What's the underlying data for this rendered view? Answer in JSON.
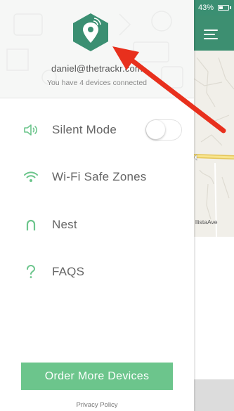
{
  "drawer": {
    "email": "daniel@thetrackr.com",
    "devices_text": "You have 4 devices connected",
    "menu": [
      {
        "label": "Silent Mode",
        "icon": "speaker-icon"
      },
      {
        "label": "Wi-Fi Safe Zones",
        "icon": "wifi-icon"
      },
      {
        "label": "Nest",
        "icon": "nest-icon"
      },
      {
        "label": "FAQS",
        "icon": "question-icon"
      }
    ],
    "silent_mode_on": false,
    "order_button": "Order More Devices",
    "privacy_link": "Privacy Policy"
  },
  "status_bar": {
    "battery_text": "43%",
    "battery_level": 0.43
  },
  "map": {
    "street_label": "llistaAve"
  },
  "colors": {
    "accent_green": "#6cc58c",
    "logo_teal": "#3b8f72",
    "header_bg": "#f6f7f6",
    "annotation_red": "#e8301d"
  },
  "icons": [
    "trackr-logo-icon",
    "menu-icon",
    "battery-icon",
    "arrow-annotation"
  ]
}
